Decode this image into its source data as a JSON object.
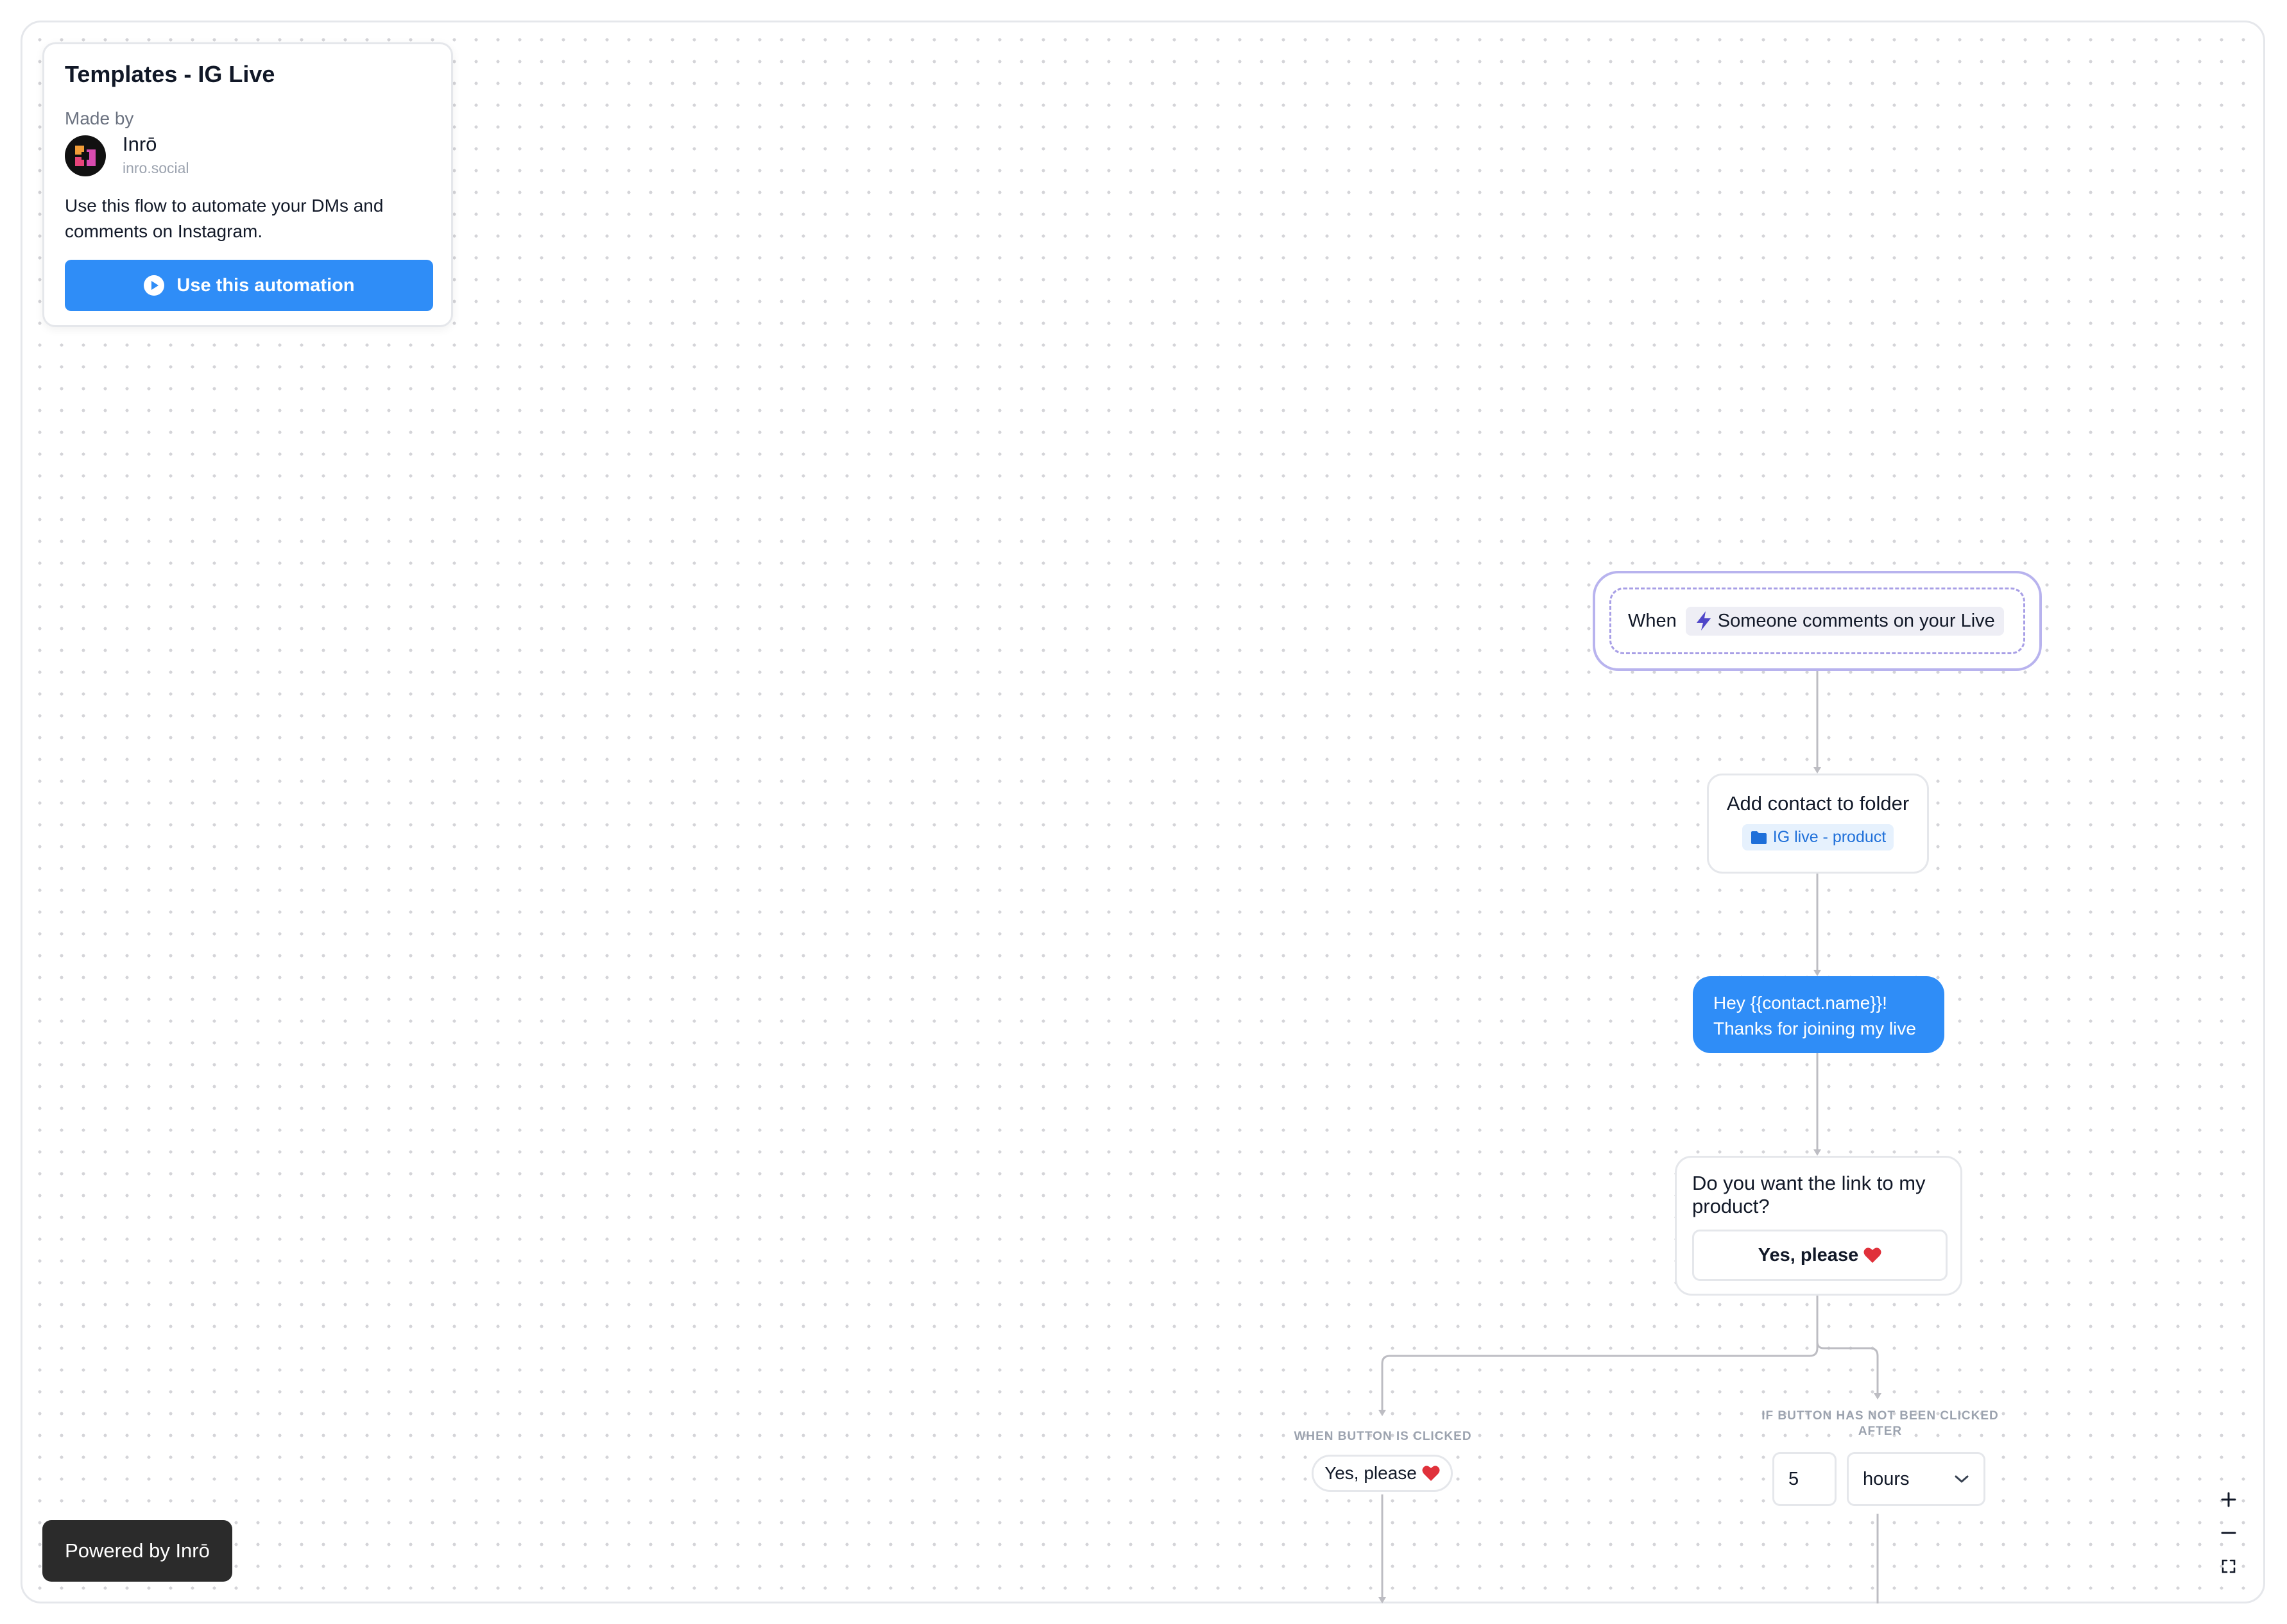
{
  "template": {
    "title": "Templates - IG Live",
    "made_by_label": "Made by",
    "author_name": "Inrō",
    "author_site": "inro.social",
    "description": "Use this flow to automate your DMs and comments on Instagram.",
    "cta_label": "Use this automation",
    "cta_icon": "play-circle-icon"
  },
  "flow": {
    "trigger": {
      "when_label": "When",
      "event_label": "Someone comments on your Live",
      "icon": "lightning-bolt-icon"
    },
    "add_contact": {
      "title": "Add contact to folder",
      "folder_label": "IG live - product",
      "icon": "folder-icon"
    },
    "message": {
      "line1": "Hey {{contact.name}}!",
      "line2": "Thanks for joining my live"
    },
    "question": {
      "text": "Do you want the link to my product?",
      "button_label": "Yes, please"
    },
    "branch_clicked": {
      "label": "When button is clicked",
      "chip_label": "Yes, please"
    },
    "branch_not_clicked": {
      "label_line1": "If button has not been clicked",
      "label_line2": "after",
      "delay_value": "5",
      "delay_unit": "hours"
    }
  },
  "footer": {
    "powered_by": "Powered by Inrō"
  },
  "colors": {
    "accent_blue": "#2f8df7",
    "trigger_border": "#b8b3ee",
    "folder_tag_bg": "#e6f1fd",
    "heart_red": "#e0313b",
    "dark_badge": "#2b2b2b"
  }
}
